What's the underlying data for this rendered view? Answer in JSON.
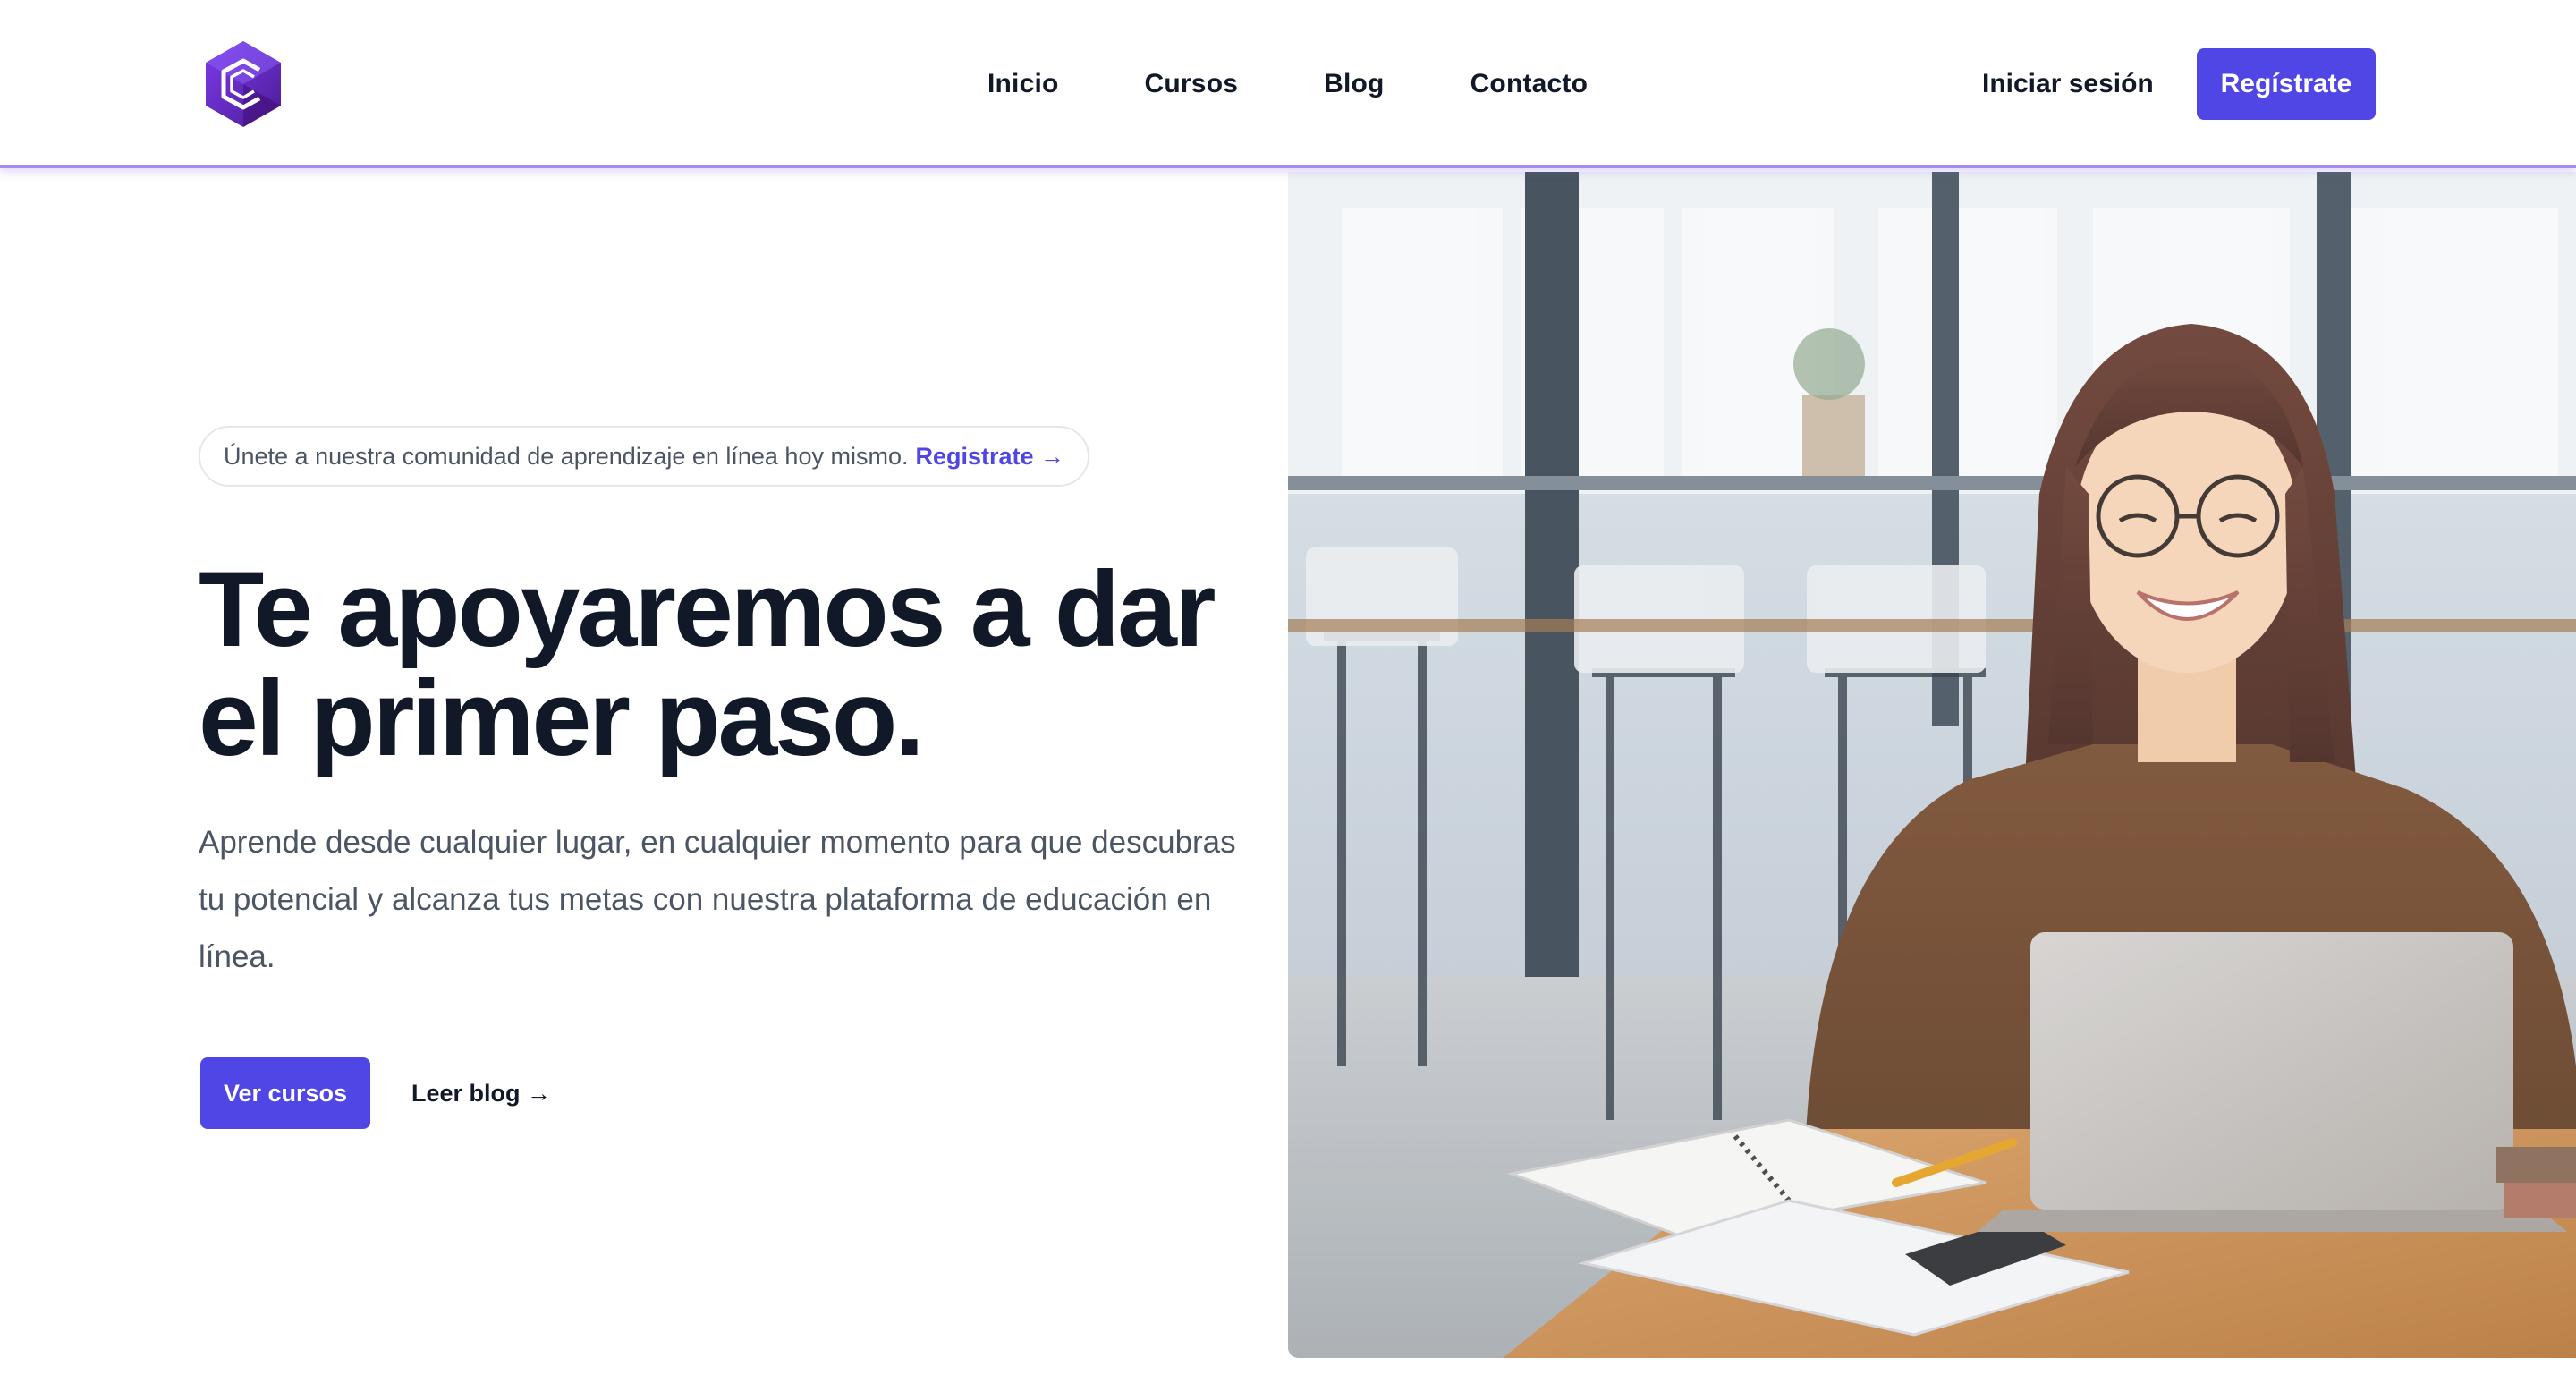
{
  "header": {
    "logo_name": "hexagon-c-logo",
    "nav": [
      {
        "label": "Inicio"
      },
      {
        "label": "Cursos"
      },
      {
        "label": "Blog"
      },
      {
        "label": "Contacto"
      }
    ],
    "login_label": "Iniciar sesión",
    "signup_label": "Regístrate"
  },
  "hero": {
    "announcement_text": "Únete a nuestra comunidad de aprendizaje en línea hoy mismo.",
    "announcement_link": "Registrate →",
    "title_line1": "Te apoyaremos a dar",
    "title_line2": "el primer paso.",
    "subtitle": "Aprende desde cualquier lugar, en cualquier momento para que descubras tu potencial y alcanza tus metas con nuestra plataforma de educación en línea.",
    "primary_cta": "Ver cursos",
    "secondary_cta": "Leer blog →"
  },
  "colors": {
    "brand": "#4f46e5",
    "heading": "#111827",
    "body_text": "#4b5563",
    "header_border": "#a48bf2"
  }
}
